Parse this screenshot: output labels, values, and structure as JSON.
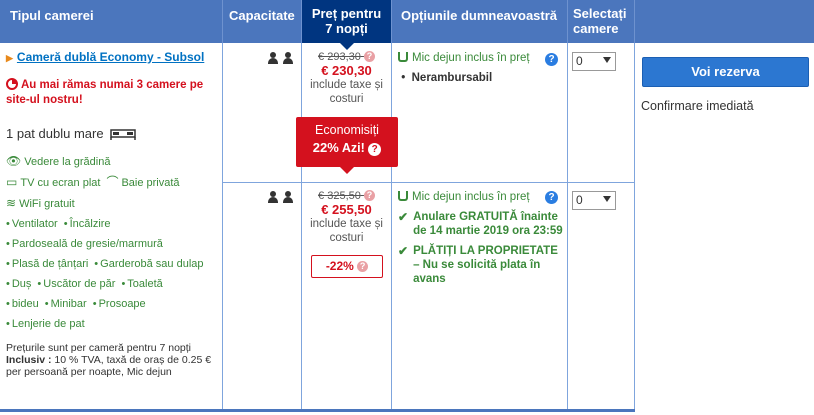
{
  "header": {
    "room_type": "Tipul camerei",
    "capacity": "Capacitate",
    "price_line1": "Preț pentru",
    "price_line2": "7 nopți",
    "options": "Opțiunile dumneavoastră",
    "select_line1": "Selectați",
    "select_line2": "camere"
  },
  "room": {
    "title": "Cameră dublă Economy - Subsol",
    "scarcity": "Au mai rămas numai 3 camere pe site-ul nostru!",
    "bed": "1 pat dublu mare",
    "features": {
      "garden": "Vedere la grădină",
      "tv": "TV cu ecran plat",
      "bath": "Baie privată",
      "wifi": "WiFi gratuit",
      "items": [
        "Ventilator",
        "Încălzire",
        "Pardoseală de gresie/marmură",
        "Plasă de țânțari",
        "Garderobă sau dulap",
        "Duș",
        "Uscător de păr",
        "Toaletă",
        "bideu",
        "Minibar",
        "Prosoape",
        "Lenjerie de pat"
      ]
    },
    "note_line": "Prețurile sunt per cameră pentru 7 nopți",
    "note_bold": "Inclusiv :",
    "note_rest": " 10 % TVA, taxă de oraș de 0.25 € per persoană per noapte, Mic dejun"
  },
  "offers": [
    {
      "old_price": "€ 293,30",
      "new_price": "€ 230,30",
      "taxes": "include taxe și costuri",
      "savings_label": "Economisiți",
      "savings_pct": "22%",
      "savings_suffix": " Azi!",
      "meal": "Mic dejun inclus în preț",
      "condition": "Nerambursabil",
      "select_value": "0"
    },
    {
      "old_price": "€ 325,50",
      "new_price": "€ 255,50",
      "taxes": "include taxe și costuri",
      "discount": "-22%",
      "meal": "Mic dejun inclus în preț",
      "cancel": "Anulare GRATUITĂ înainte de 14 martie 2019 ora 23:59",
      "pay": "PLĂTIȚI LA PROPRIETATE – Nu se solicită plata în avans",
      "select_value": "0"
    }
  ],
  "reserve": {
    "button": "Voi rezerva",
    "confirm": "Confirmare imediată"
  },
  "colors": {
    "header_blue": "#4b76bd",
    "price_header": "#003580",
    "red": "#d4111e",
    "green": "#3a8a3a",
    "link_blue": "#0071c2",
    "button_blue": "#2c77d1"
  }
}
